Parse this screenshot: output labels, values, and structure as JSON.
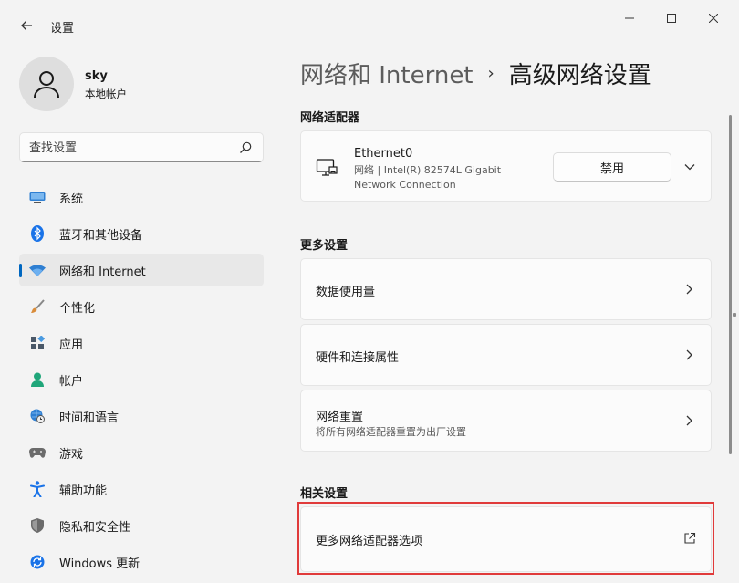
{
  "app": {
    "title": "设置",
    "window_controls": [
      "minimize",
      "maximize",
      "close"
    ]
  },
  "profile": {
    "name": "sky",
    "account_type": "本地帐户"
  },
  "search": {
    "placeholder": "查找设置"
  },
  "sidebar": {
    "items": [
      {
        "label": "系统",
        "icon": "system-icon",
        "color": "#2f7fd2"
      },
      {
        "label": "蓝牙和其他设备",
        "icon": "bluetooth-icon",
        "color": "#1a73e8"
      },
      {
        "label": "网络和 Internet",
        "icon": "wifi-icon",
        "color": "#2f7fd2",
        "active": true
      },
      {
        "label": "个性化",
        "icon": "brush-icon",
        "color": "#d98c3a"
      },
      {
        "label": "应用",
        "icon": "apps-icon",
        "color": "#4a5868"
      },
      {
        "label": "帐户",
        "icon": "account-icon",
        "color": "#20a67a"
      },
      {
        "label": "时间和语言",
        "icon": "globe-clock-icon",
        "color": "#2f7fd2"
      },
      {
        "label": "游戏",
        "icon": "gamepad-icon",
        "color": "#6b6b6b"
      },
      {
        "label": "辅助功能",
        "icon": "accessibility-icon",
        "color": "#1a73e8"
      },
      {
        "label": "隐私和安全性",
        "icon": "shield-icon",
        "color": "#6b6b6b"
      },
      {
        "label": "Windows 更新",
        "icon": "update-icon",
        "color": "#1a73e8"
      }
    ]
  },
  "breadcrumb": {
    "parent": "网络和 Internet",
    "separator": "›",
    "current": "高级网络设置"
  },
  "sections": {
    "adapters": "网络适配器",
    "more": "更多设置",
    "related": "相关设置"
  },
  "adapter": {
    "name": "Ethernet0",
    "desc_line1": "网络 | Intel(R) 82574L Gigabit",
    "desc_line2": "Network Connection",
    "disable_label": "禁用"
  },
  "more_settings": [
    {
      "title": "数据使用量"
    },
    {
      "title": "硬件和连接属性"
    },
    {
      "title": "网络重置",
      "subtitle": "将所有网络适配器重置为出厂设置"
    }
  ],
  "related_settings": [
    {
      "title": "更多网络适配器选项",
      "external": true
    }
  ],
  "colors": {
    "accent": "#0067c0",
    "highlight": "#e03a3a"
  }
}
